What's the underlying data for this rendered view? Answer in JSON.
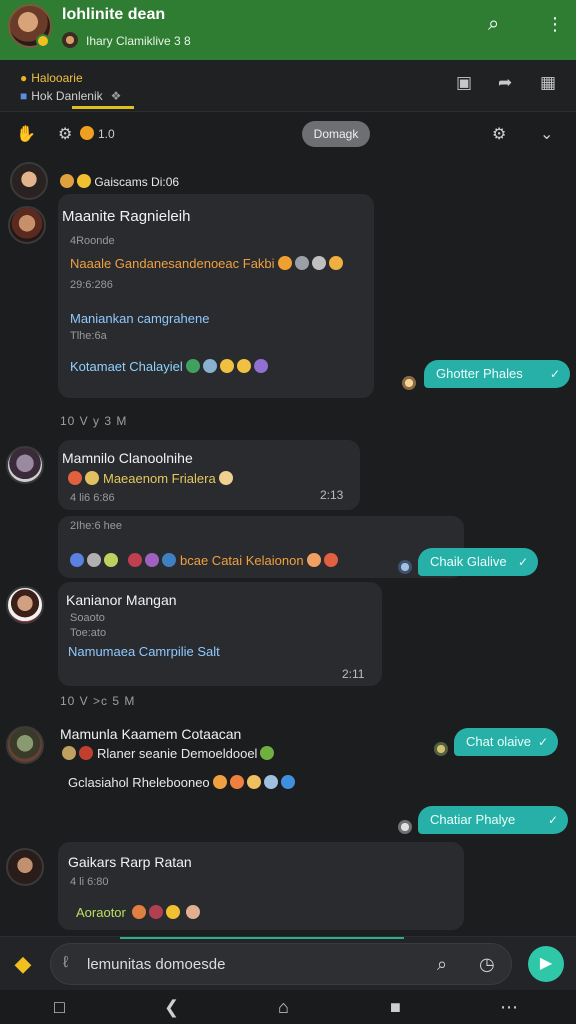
{
  "header": {
    "title": "lohlinite dean",
    "subtitle": "Ihary Clamiklive   3  8",
    "icons": [
      "search-icon",
      "more-vert-icon"
    ]
  },
  "toolbar": {
    "row1": "Halooarie",
    "row2": "Hok Danlenik",
    "icons": [
      "chat-icon",
      "share-icon",
      "expand-icon"
    ]
  },
  "filter": {
    "count": "1.0",
    "pill": "Domagk",
    "icons": [
      "hand-icon",
      "settings-icon",
      "gear-icon",
      "chevron-down-icon"
    ]
  },
  "messages": [
    {
      "header_line": "Gaiscams   Di:06",
      "name": "Maanite Ragnieleih",
      "lines": [
        {
          "text": "4Roonde",
          "kind": "small"
        },
        {
          "text": "Naaale Gandanesandenoeac Fakbi",
          "kind": "orange"
        },
        {
          "text": "29:6:286",
          "kind": "small"
        },
        {
          "text": "Maniankan camgrahene",
          "kind": "blue"
        },
        {
          "text": "Tlhe:6a",
          "kind": "small"
        },
        {
          "text": "Kotamaet  Chalayiel",
          "kind": "cyan-yellow"
        }
      ],
      "meta": "10   V   y   3 M",
      "reply": "Ghotter Phales"
    },
    {
      "name": "Mamnilo Clanoolnihe",
      "lines": [
        {
          "text": "Maeaenom Frialera",
          "kind": "yellow"
        },
        {
          "text": "4 li6 6:86",
          "kind": "small"
        }
      ],
      "time": "2:13"
    },
    {
      "lines": [
        {
          "text": "2Ihe:6 hee",
          "kind": "small"
        },
        {
          "text": "bcae Catai Kelaionon",
          "kind": "orange-blue"
        }
      ],
      "reply": "Chaik Glalive"
    },
    {
      "name": "Kanianor Mangan",
      "lines": [
        {
          "text": "Soaoto",
          "kind": "small"
        },
        {
          "text": "Toe:ato",
          "kind": "small"
        },
        {
          "text": "Namumaea Camrpilie Salt",
          "kind": "blue"
        }
      ],
      "time": "2:11",
      "meta": "10   V   >c   5 M"
    },
    {
      "name": "Mamunla Kaamem  Cotaacan",
      "lines": [
        {
          "text": "Rlaner seanie  Demoeldooel",
          "kind": "white"
        },
        {
          "text": "Gclasiahol  Rhelebooneo",
          "kind": "white-red"
        }
      ],
      "reply": "Chat olaive",
      "reply2": "Chatiar  Phalye"
    },
    {
      "name": "Gaikars Rarp Ratan",
      "lines": [
        {
          "text": "4 li 6:80",
          "kind": "small"
        },
        {
          "text": "Aoraotor",
          "kind": "green"
        }
      ]
    }
  ],
  "input": {
    "value": "lemunitas domoesde",
    "icons": [
      "attach-icon",
      "search-icon",
      "clock-icon",
      "send-icon"
    ]
  },
  "nav": {
    "icons": [
      "message-icon",
      "back-icon",
      "home-icon",
      "square-icon",
      "grid-icon"
    ]
  },
  "colors": {
    "header": "#2f7d32",
    "accent": "#26b0a8",
    "background": "#1c1d1f"
  }
}
